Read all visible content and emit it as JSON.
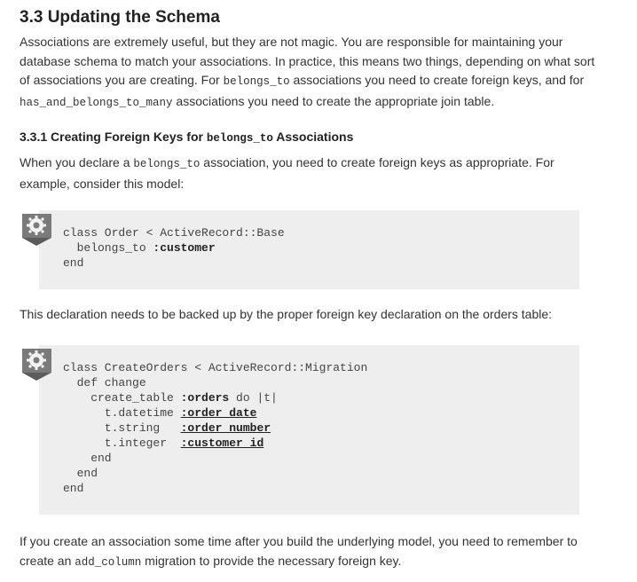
{
  "section": {
    "heading": "3.3 Updating the Schema",
    "intro": {
      "s1": "Associations are extremely useful, but they are not magic. You are responsible for maintaining your database schema to match your associations. In practice, this means two things, depending on what sort of associations you are creating. For ",
      "c1": "belongs_to",
      "s2": " associations you need to create foreign keys, and for ",
      "c2": "has_and_belongs_to_many",
      "s3": " associations you need to create the appropriate join table."
    }
  },
  "subsection": {
    "heading_pre": "3.3.1 Creating Foreign Keys for ",
    "heading_code": "belongs_to",
    "heading_post": " Associations",
    "p1": {
      "s1": "When you declare a ",
      "c1": "belongs_to",
      "s2": " association, you need to create foreign keys as appropriate. For example, consider this model:"
    },
    "p2": "This declaration needs to be backed up by the proper foreign key declaration on the orders table:",
    "p3": {
      "s1": "If you create an association some time after you build the underlying model, you need to remember to create an ",
      "c1": "add_column",
      "s2": " migration to provide the necessary foreign key."
    }
  },
  "code1": {
    "l1": "class Order < ActiveRecord::Base",
    "l2_kw": "  belongs_to ",
    "l2_sym": ":customer",
    "l3": "end"
  },
  "code2": {
    "l1": "class CreateOrders < ActiveRecord::Migration",
    "l2": "  def change",
    "l3_pre": "    create_table ",
    "l3_sym": ":orders",
    "l3_post": " do |t|",
    "l4_pre": "      t.datetime ",
    "l4_sym": ":order_date",
    "l5_pre": "      t.string   ",
    "l5_sym": ":order_number",
    "l6_pre": "      t.integer  ",
    "l6_sym": ":customer_id",
    "l7": "    end",
    "l8": "  end",
    "l9": "end"
  },
  "icons": {
    "code_box_icon": "gear-icon"
  },
  "colors": {
    "code_background": "#eeeeee",
    "text": "#333333"
  }
}
